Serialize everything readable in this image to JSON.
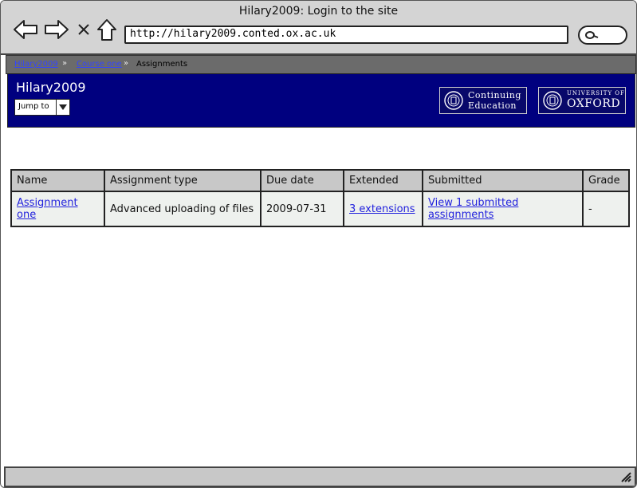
{
  "window": {
    "title": "Hilary2009: Login to the site"
  },
  "browser": {
    "url": "http://hilary2009.conted.ox.ac.uk",
    "icons": [
      "back-icon",
      "forward-icon",
      "close-icon",
      "home-icon",
      "search-icon"
    ]
  },
  "breadcrumb": [
    {
      "label": "Hilary2009",
      "link": true
    },
    {
      "label": "Course one",
      "link": true
    },
    {
      "label": "Assignments",
      "link": false
    }
  ],
  "header": {
    "site_title": "Hilary2009",
    "jump_label": "Jump to",
    "logo_ce": {
      "line1": "Continuing",
      "line2": "Education"
    },
    "logo_ox": {
      "line1": "UNIVERSITY OF",
      "line2": "OXFORD"
    }
  },
  "table": {
    "columns": [
      "Name",
      "Assignment type",
      "Due date",
      "Extended",
      "Submitted",
      "Grade"
    ],
    "rows": [
      {
        "name": "Assignment one",
        "type": "Advanced uploading of files",
        "due": "2009-07-31",
        "extended": "3 extensions",
        "submitted": "View 1 submitted assignments",
        "grade": "-"
      }
    ]
  },
  "colors": {
    "header_bg": "#00007f",
    "link": "#2222dd",
    "breadcrumb_bg": "#6b6b6b"
  }
}
